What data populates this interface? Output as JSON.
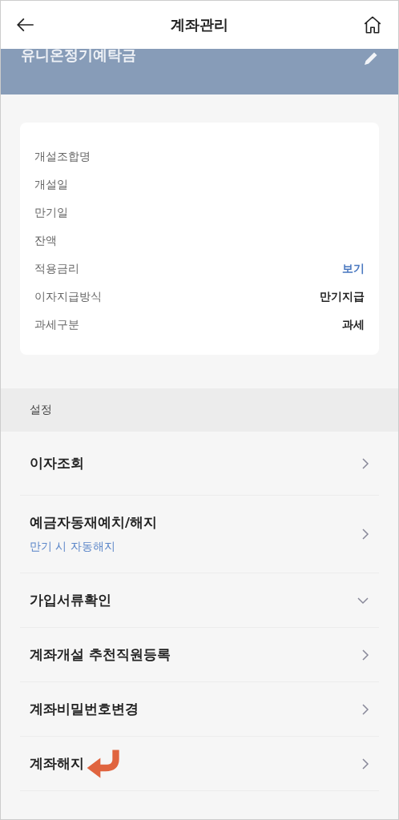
{
  "header": {
    "title": "계좌관리"
  },
  "account": {
    "name": "유니온정기예탁금"
  },
  "details": [
    {
      "label": "개설조합명"
    },
    {
      "label": "개설일"
    },
    {
      "label": "만기일"
    },
    {
      "label": "잔액"
    },
    {
      "label": "적용금리",
      "value": "보기",
      "kind": "link"
    },
    {
      "label": "이자지급방식",
      "value": "만기지급",
      "kind": "text"
    },
    {
      "label": "과세구분",
      "value": "과세",
      "kind": "text"
    }
  ],
  "section": {
    "title": "설정"
  },
  "menu": [
    {
      "label": "이자조회",
      "kind": "link",
      "annotated": false
    },
    {
      "label": "예금자동재예치/해지",
      "sub": "만기 시 자동해지",
      "kind": "link",
      "annotated": false
    },
    {
      "label": "가입서류확인",
      "kind": "accordion",
      "expanded": false,
      "annotated": false
    },
    {
      "label": "계좌개설 추천직원등록",
      "kind": "link",
      "annotated": false
    },
    {
      "label": "계좌비밀번호변경",
      "kind": "link",
      "annotated": false
    },
    {
      "label": "계좌해지",
      "kind": "link",
      "annotated": true
    }
  ]
}
